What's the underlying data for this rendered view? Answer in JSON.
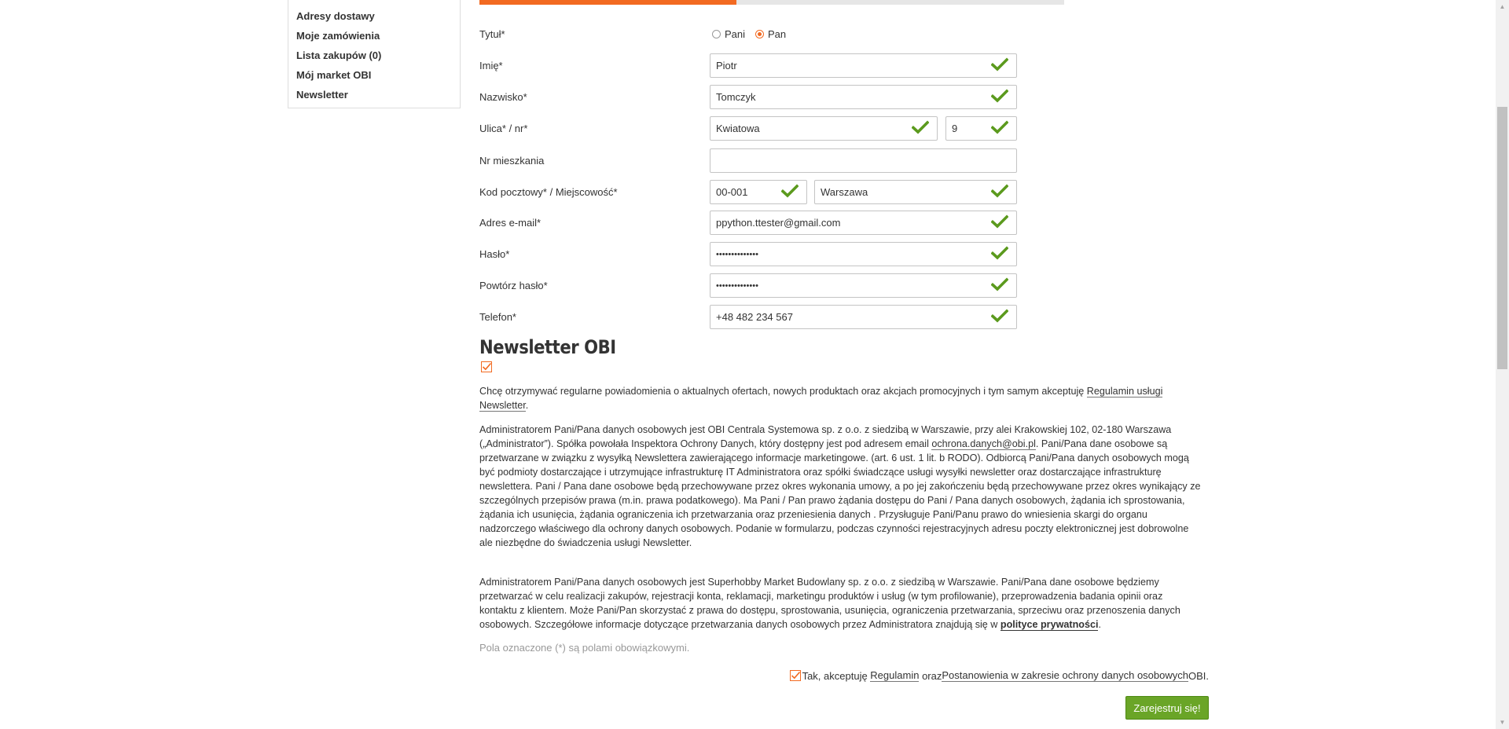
{
  "sidebar": {
    "items": [
      {
        "label": "Adresy dostawy"
      },
      {
        "label": "Moje zamówienia"
      },
      {
        "label": "Lista zakupów (0)"
      },
      {
        "label": "Mój market OBI"
      },
      {
        "label": "Newsletter"
      }
    ]
  },
  "progress": {
    "fraction": 0.44
  },
  "form": {
    "title_label": "Tytuł*",
    "title_options": [
      "Pani",
      "Pan"
    ],
    "title_selected": "Pan",
    "first_name_label": "Imię*",
    "first_name_value": "Piotr",
    "last_name_label": "Nazwisko*",
    "last_name_value": "Tomczyk",
    "street_label": "Ulica* / nr*",
    "street_value": "Kwiatowa",
    "house_number_value": "9",
    "apartment_label": "Nr mieszkania",
    "apartment_value": "",
    "postal_label": "Kod pocztowy* / Miejscowość*",
    "postal_value": "00-001",
    "city_value": "Warszawa",
    "email_label": "Adres e-mail*",
    "email_value": "ppython.ttester@gmail.com",
    "password_label": "Hasło*",
    "password_value": "••••••••••••••",
    "password_repeat_label": "Powtórz hasło*",
    "password_repeat_value": "••••••••••••••",
    "phone_label": "Telefon*",
    "phone_value": "+48 482 234 567"
  },
  "newsletter": {
    "heading": "Newsletter OBI",
    "checked": true,
    "consent_text": "Chcę otrzymywać regularne powiadomienia o aktualnych ofertach, nowych produktach oraz akcjach promocyjnych i tym samym akceptuję ",
    "consent_link": "Regulamin usługi Newsletter",
    "consent_end": ".",
    "admin1_text_a": "Administratorem Pani/Pana danych osobowych jest OBI Centrala Systemowa sp. z o.o. z siedzibą w Warszawie, przy alei Krakowskiej 102, 02-180 Warszawa („Administrator”). Spółka powołała Inspektora Ochrony Danych, który dostępny jest pod adresem email ",
    "admin1_email": "ochrona.danych@obi.pl",
    "admin1_text_b": ". Pani/Pana dane osobowe są przetwarzane w związku z wysyłką Newslettera zawierającego informacje marketingowe. (art. 6 ust. 1 lit. b RODO). Odbiorcą Pani/Pana danych osobowych mogą być podmioty dostarczające i utrzymujące infrastrukturę IT Administratora oraz spółki świadczące usługi wysyłki newsletter oraz dostarczające infrastrukturę newslettera. Pani / Pana dane osobowe będą przechowywane przez okres wykonania umowy, a po jej zakończeniu będą przechowywane przez okres wynikający ze szczególnych przepisów prawa (m.in. prawa podatkowego). Ma Pani / Pan prawo żądania dostępu do Pani / Pana danych osobowych, żądania ich sprostowania, żądania ich usunięcia, żądania ograniczenia ich przetwarzania oraz przeniesienia danych . Przysługuje Pani/Panu prawo do wniesienia skargi do organu nadzorczego właściwego dla ochrony danych osobowych. Podanie w formularzu, podczas czynności rejestracyjnych adresu poczty elektronicznej jest dobrowolne ale niezbędne do świadczenia usługi Newsletter.",
    "admin2_text": "Administratorem Pani/Pana danych osobowych jest Superhobby Market Budowlany sp. z o.o. z siedzibą w Warszawie. Pani/Pana dane osobowe będziemy przetwarzać w celu realizacji zakupów, rejestracji konta, reklamacji, marketingu produktów i usług (w tym profilowanie), przeprowadzenia badania opinii oraz kontaktu z klientem. Może Pani/Pan skorzystać z prawa do dostępu, sprostowania, usunięcia, ograniczenia przetwarzania, sprzeciwu oraz przenoszenia danych osobowych. Szczegółowe informacje dotyczące przetwarzania danych osobowych przez Administratora znajdują się w ",
    "admin2_link": "polityce prywatności",
    "admin2_end": "."
  },
  "required_note": "Pola oznaczone (*) są polami obowiązkowymi.",
  "accept": {
    "checked": true,
    "prefix": "Tak, akceptuję ",
    "link1": "Regulamin",
    "middle": " oraz",
    "link2": "Postanowienia w zakresie ochrony danych osobowych",
    "suffix": "OBI."
  },
  "submit_label": "Zarejestruj się!",
  "colors": {
    "accent": "#f26a21",
    "success": "#6aa527",
    "check": "#5b9a1d"
  }
}
